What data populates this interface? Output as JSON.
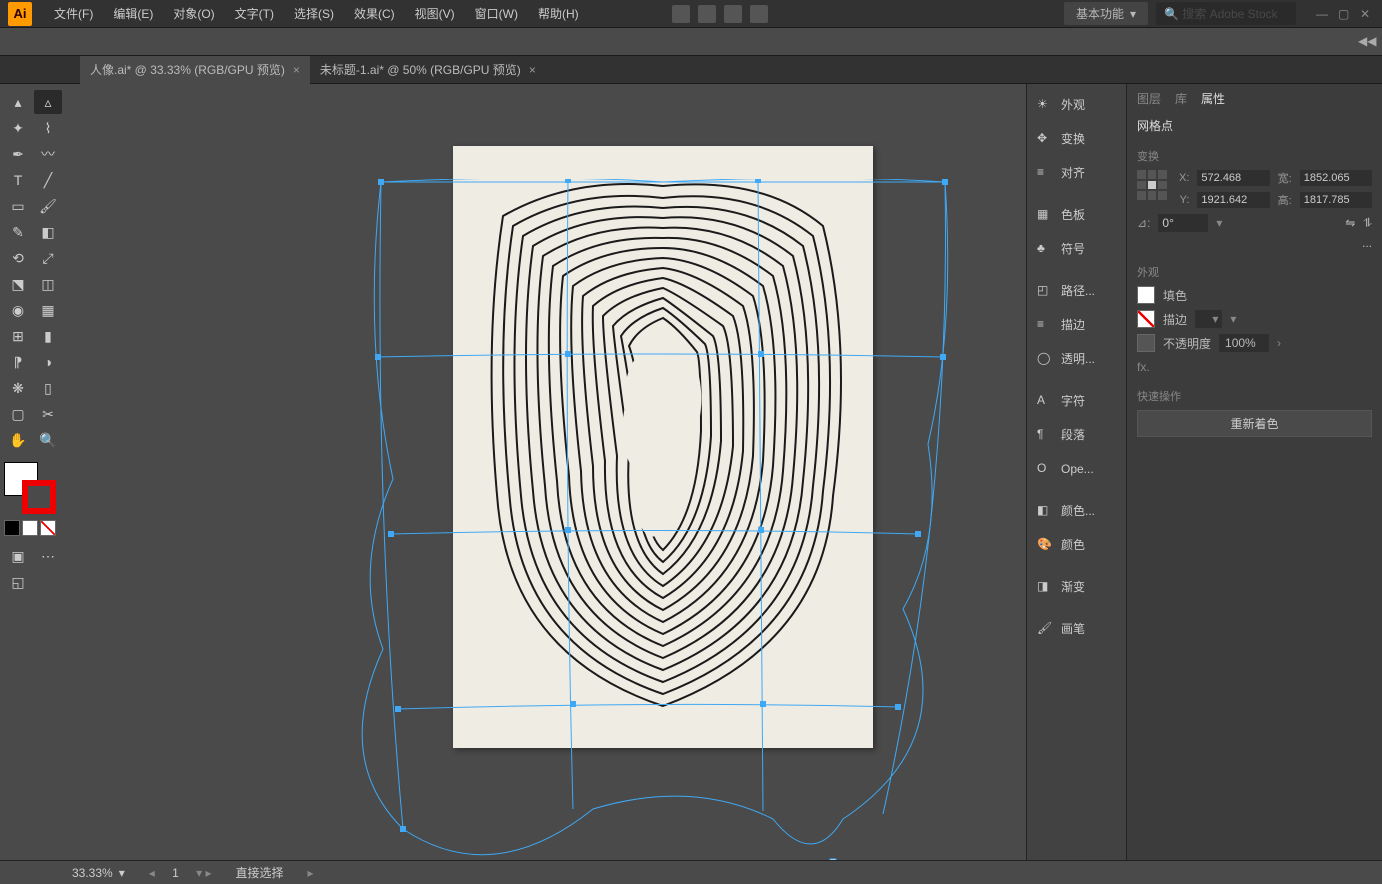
{
  "app": {
    "logo_text": "Ai"
  },
  "menu": [
    "文件(F)",
    "编辑(E)",
    "对象(O)",
    "文字(T)",
    "选择(S)",
    "效果(C)",
    "视图(V)",
    "窗口(W)",
    "帮助(H)"
  ],
  "workspace": {
    "label": "基本功能",
    "search_placeholder": "搜索 Adobe Stock"
  },
  "tabs": [
    {
      "label": "人像.ai* @ 33.33% (RGB/GPU 预览)",
      "active": true
    },
    {
      "label": "未标题-1.ai* @ 50% (RGB/GPU 预览)",
      "active": false
    }
  ],
  "dock": {
    "groups": [
      [
        "外观",
        "变换",
        "对齐"
      ],
      [
        "色板",
        "符号"
      ],
      [
        "路径...",
        "描边",
        "透明..."
      ],
      [
        "字符",
        "段落",
        "Ope..."
      ],
      [
        "颜色...",
        "颜色"
      ],
      [
        "渐变"
      ],
      [
        "画笔"
      ]
    ]
  },
  "panel": {
    "tabs": [
      "图层",
      "库",
      "属性"
    ],
    "active_tab": 2,
    "heading": "网格点",
    "transform_label": "变换",
    "x_label": "X:",
    "x_val": "572.468",
    "w_label": "宽:",
    "w_val": "1852.065",
    "y_label": "Y:",
    "y_val": "1921.642",
    "h_label": "高:",
    "h_val": "1817.785",
    "angle_label": "⊿:",
    "angle_val": "0°",
    "more": "...",
    "appearance_label": "外观",
    "fill_label": "填色",
    "stroke_label": "描边",
    "stroke_weight_sel": "⌄",
    "opacity_label": "不透明度",
    "opacity_val": "100%",
    "fx_label": "fx.",
    "quick_label": "快速操作",
    "recolor_btn": "重新着色"
  },
  "status": {
    "zoom": "33.33%",
    "artboard_num": "1",
    "selection_tool": "直接选择"
  }
}
